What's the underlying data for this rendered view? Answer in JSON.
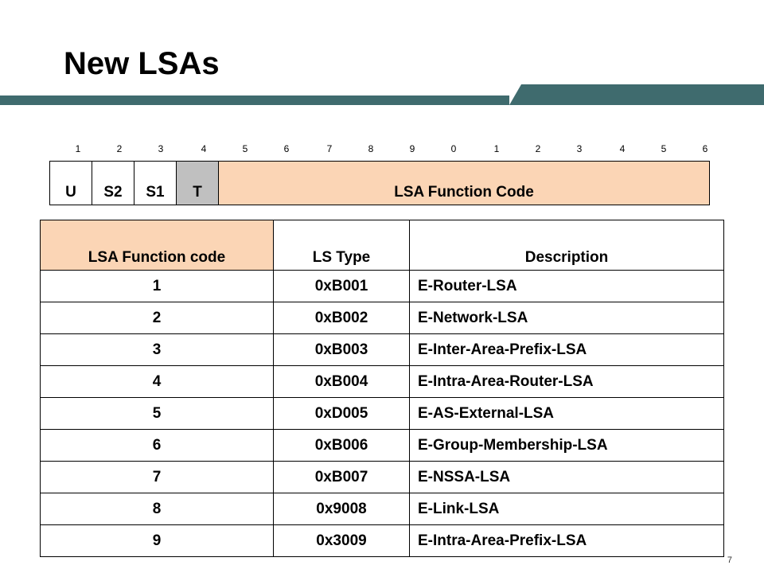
{
  "slide": {
    "title": "New LSAs",
    "page_number": "7",
    "colors": {
      "bar": "#3f6b6e",
      "header_fill": "#fbd5b5",
      "t_fill": "#c0c0c0"
    }
  },
  "bit_ruler": [
    "1",
    "2",
    "3",
    "4",
    "5",
    "6",
    "7",
    "8",
    "9",
    "0",
    "1",
    "2",
    "3",
    "4",
    "5",
    "6"
  ],
  "lsa_header": {
    "fields": [
      "U",
      "S2",
      "S1",
      "T"
    ],
    "function_code_label": "LSA Function Code"
  },
  "table": {
    "headers": [
      "LSA Function code",
      "LS Type",
      "Description"
    ],
    "rows": [
      {
        "code": "1",
        "type": "0xB001",
        "desc": "E-Router-LSA"
      },
      {
        "code": "2",
        "type": "0xB002",
        "desc": "E-Network-LSA"
      },
      {
        "code": "3",
        "type": "0xB003",
        "desc": "E-Inter-Area-Prefix-LSA"
      },
      {
        "code": "4",
        "type": "0xB004",
        "desc": "E-Intra-Area-Router-LSA"
      },
      {
        "code": "5",
        "type": "0xD005",
        "desc": "E-AS-External-LSA"
      },
      {
        "code": "6",
        "type": "0xB006",
        "desc": "E-Group-Membership-LSA"
      },
      {
        "code": "7",
        "type": "0xB007",
        "desc": "E-NSSA-LSA"
      },
      {
        "code": "8",
        "type": "0x9008",
        "desc": "E-Link-LSA"
      },
      {
        "code": "9",
        "type": "0x3009",
        "desc": "E-Intra-Area-Prefix-LSA"
      }
    ]
  }
}
